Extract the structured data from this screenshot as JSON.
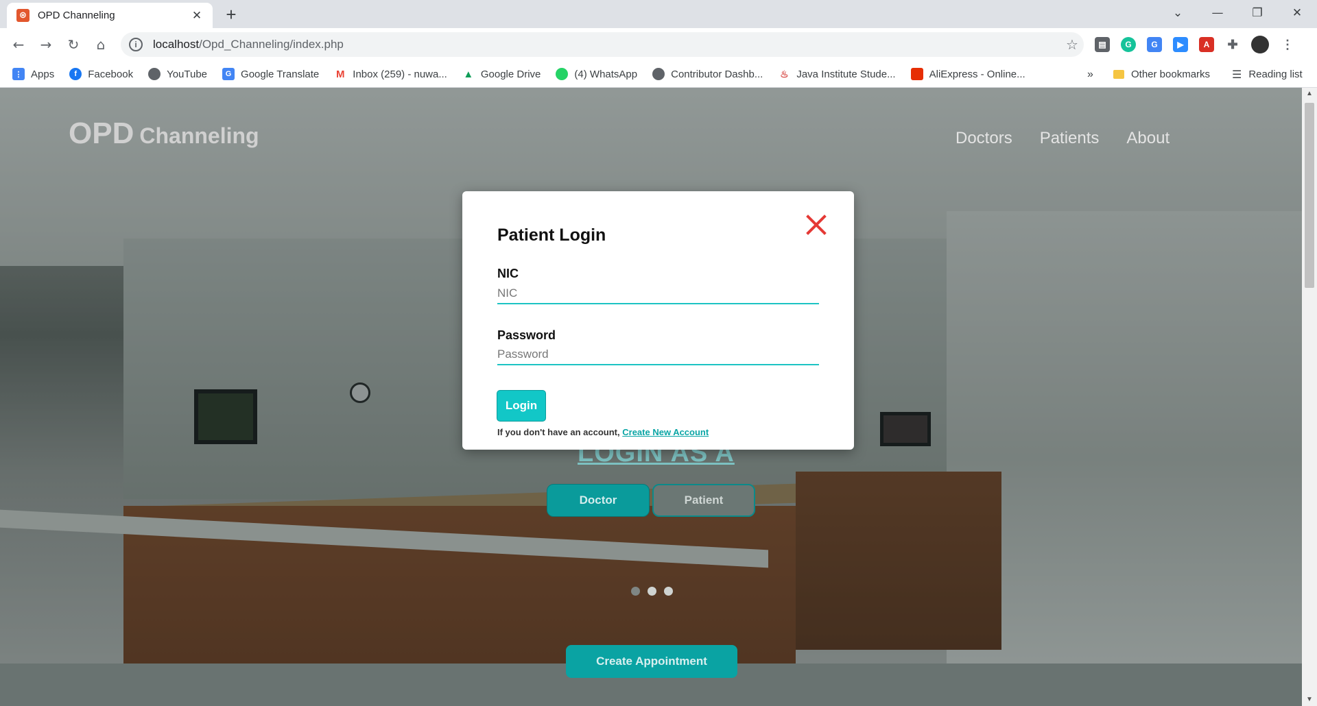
{
  "browser": {
    "tab_title": "OPD Channeling",
    "url_host": "localhost",
    "url_path": "/Opd_Channeling/index.php",
    "bookmarks": [
      {
        "label": "Apps",
        "icon": "apps-grid-icon",
        "color": "#4285f4"
      },
      {
        "label": "Facebook",
        "icon": "facebook-icon",
        "color": "#1877f2"
      },
      {
        "label": "YouTube",
        "icon": "globe-icon",
        "color": "#5f6368"
      },
      {
        "label": "Google Translate",
        "icon": "translate-icon",
        "color": "#4285f4"
      },
      {
        "label": "Inbox (259) - nuwa...",
        "icon": "gmail-icon",
        "color": "#ea4335"
      },
      {
        "label": "Google Drive",
        "icon": "drive-icon",
        "color": "#0f9d58"
      },
      {
        "label": "(4) WhatsApp",
        "icon": "whatsapp-icon",
        "color": "#25d366"
      },
      {
        "label": "Contributor Dashb...",
        "icon": "globe-icon",
        "color": "#5f6368"
      },
      {
        "label": "Java Institute Stude...",
        "icon": "java-icon",
        "color": "#d9534f"
      },
      {
        "label": "AliExpress - Online...",
        "icon": "aliexpress-icon",
        "color": "#e62e04"
      }
    ],
    "other_bookmarks": "Other bookmarks",
    "reading_list": "Reading list"
  },
  "site": {
    "brand_big": "OPD",
    "brand_small": "Channeling",
    "nav": [
      "Doctors",
      "Patients",
      "About"
    ],
    "login_as": "LOGIN AS A",
    "doctor_button": "Doctor",
    "patient_button": "Patient",
    "create_appointment": "Create Appointment"
  },
  "modal": {
    "title": "Patient Login",
    "nic_label": "NIC",
    "nic_placeholder": "NIC",
    "password_label": "Password",
    "password_placeholder": "Password",
    "login_button": "Login",
    "signup_text": "If you don't have an account,",
    "signup_link": "Create New Account"
  },
  "colors": {
    "accent": "#12c7c7",
    "close": "#e53935"
  }
}
